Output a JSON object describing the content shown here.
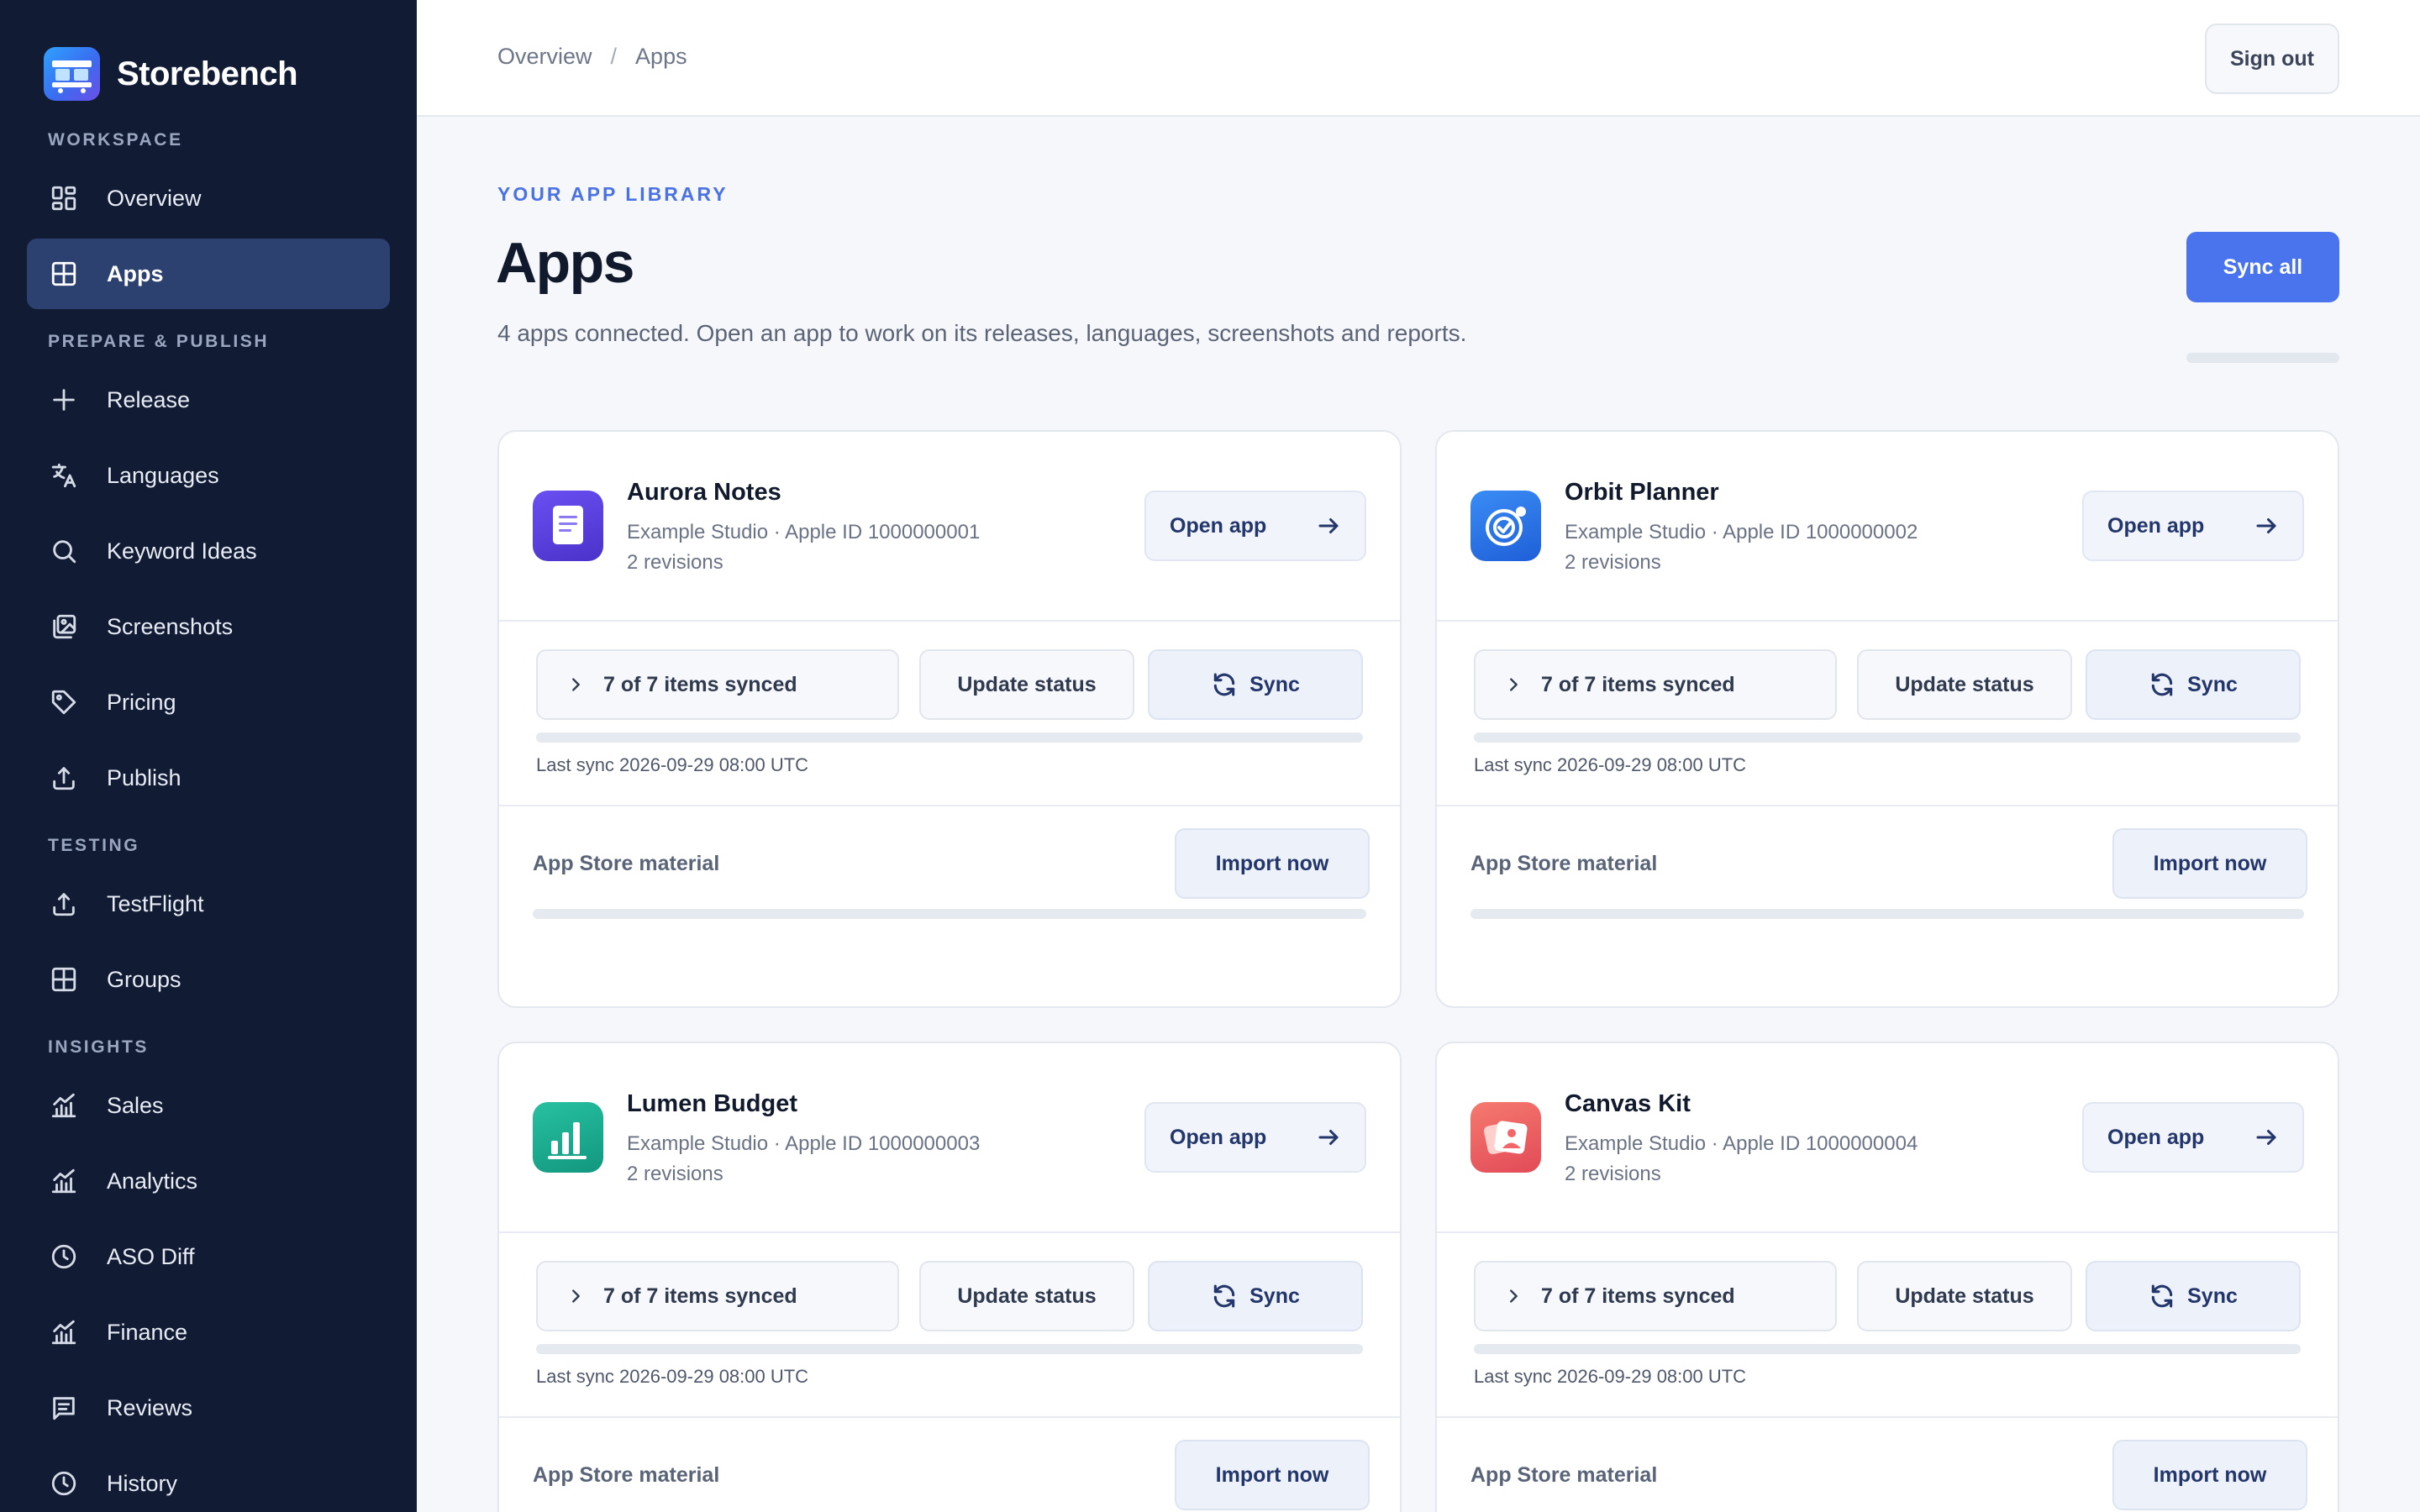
{
  "brand": {
    "name": "Storebench",
    "logo_icon": "storefront-logo-icon"
  },
  "sidebar": {
    "sections": [
      {
        "label": "WORKSPACE",
        "items": [
          {
            "label": "Overview",
            "icon": "dashboard-icon"
          },
          {
            "label": "Apps",
            "icon": "grid-icon",
            "active": true
          }
        ]
      },
      {
        "label": "PREPARE & PUBLISH",
        "items": [
          {
            "label": "Release",
            "icon": "plus-icon"
          },
          {
            "label": "Languages",
            "icon": "translate-icon"
          },
          {
            "label": "Keyword Ideas",
            "icon": "search-icon"
          },
          {
            "label": "Screenshots",
            "icon": "image-stack-icon"
          },
          {
            "label": "Pricing",
            "icon": "tag-icon"
          },
          {
            "label": "Publish",
            "icon": "upload-icon"
          }
        ]
      },
      {
        "label": "TESTING",
        "items": [
          {
            "label": "TestFlight",
            "icon": "upload-icon"
          },
          {
            "label": "Groups",
            "icon": "grid-icon"
          }
        ]
      },
      {
        "label": "INSIGHTS",
        "items": [
          {
            "label": "Sales",
            "icon": "chart-line-icon"
          },
          {
            "label": "Analytics",
            "icon": "chart-line-icon"
          },
          {
            "label": "ASO Diff",
            "icon": "clock-icon"
          },
          {
            "label": "Finance",
            "icon": "chart-line-icon"
          },
          {
            "label": "Reviews",
            "icon": "message-icon"
          },
          {
            "label": "History",
            "icon": "clock-icon"
          }
        ]
      }
    ]
  },
  "topbar": {
    "breadcrumb": [
      "Overview",
      "Apps"
    ],
    "breadcrumb_separator": "/",
    "sign_out_label": "Sign out"
  },
  "main": {
    "eyebrow": "YOUR APP LIBRARY",
    "title": "Apps",
    "subtitle": "4 apps connected. Open an app to work on its releases, languages, screenshots and reports.",
    "sync_all_label": "Sync all"
  },
  "cards": [
    {
      "name": "Aurora Notes",
      "meta": "Example Studio · Apple ID 1000000001",
      "revisions": "2 revisions",
      "icon": "notes-icon",
      "icon_colors": [
        "#6a4ff2",
        "#4b32c9"
      ],
      "open_label": "Open app",
      "synced_label": "7 of 7 items synced",
      "status_label": "Update status",
      "sync_label": "Sync",
      "last_sync": "Last sync 2026-09-29 08:00 UTC",
      "material_label": "App Store material",
      "import_label": "Import now"
    },
    {
      "name": "Orbit Planner",
      "meta": "Example Studio · Apple ID 1000000002",
      "revisions": "2 revisions",
      "icon": "target-check-icon",
      "icon_colors": [
        "#3a8cf5",
        "#1f5fd8"
      ],
      "open_label": "Open app",
      "synced_label": "7 of 7 items synced",
      "status_label": "Update status",
      "sync_label": "Sync",
      "last_sync": "Last sync 2026-09-29 08:00 UTC",
      "material_label": "App Store material",
      "import_label": "Import now"
    },
    {
      "name": "Lumen Budget",
      "meta": "Example Studio · Apple ID 1000000003",
      "revisions": "2 revisions",
      "icon": "bar-chart-icon",
      "icon_colors": [
        "#27c1a1",
        "#12977f"
      ],
      "open_label": "Open app",
      "synced_label": "7 of 7 items synced",
      "status_label": "Update status",
      "sync_label": "Sync",
      "last_sync": "Last sync 2026-09-29 08:00 UTC",
      "material_label": "App Store material",
      "import_label": "Import now"
    },
    {
      "name": "Canvas Kit",
      "meta": "Example Studio · Apple ID 1000000004",
      "revisions": "2 revisions",
      "icon": "photo-stack-icon",
      "icon_colors": [
        "#f57a6f",
        "#e24a57"
      ],
      "open_label": "Open app",
      "synced_label": "7 of 7 items synced",
      "status_label": "Update status",
      "sync_label": "Sync",
      "last_sync": "Last sync 2026-09-29 08:00 UTC",
      "material_label": "App Store material",
      "import_label": "Import now"
    }
  ],
  "colors": {
    "sidebar_bg": "#111c34",
    "sidebar_active": "#2c4170",
    "accent": "#4a73ee",
    "page_bg": "#f6f7fa"
  }
}
